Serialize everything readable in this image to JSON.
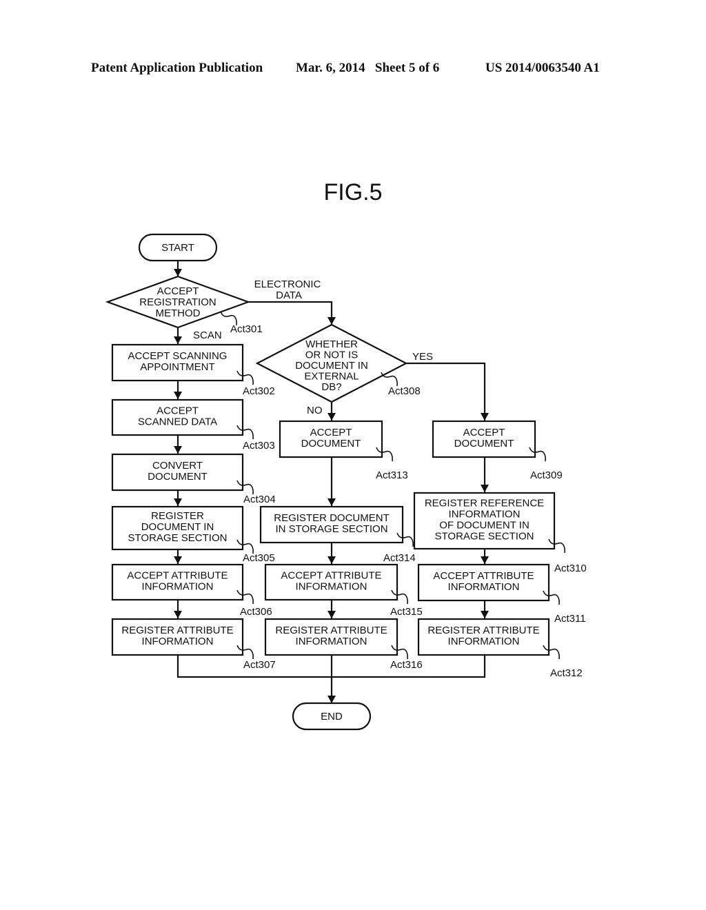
{
  "header": {
    "publication": "Patent Application Publication",
    "date_sheet": "Mar. 6, 2014   Sheet 5 of 6",
    "patent_number": "US 2014/0063540 A1"
  },
  "figure": {
    "title": "FIG.5"
  },
  "flowchart": {
    "start": "START",
    "end": "END",
    "nodes": [
      {
        "id": "Act301",
        "type": "decision",
        "lines": [
          "ACCEPT",
          "REGISTRATION",
          "METHOD"
        ],
        "ref": "Act301"
      },
      {
        "id": "Act302",
        "type": "process",
        "lines": [
          "ACCEPT SCANNING",
          "APPOINTMENT"
        ],
        "ref": "Act302"
      },
      {
        "id": "Act303",
        "type": "process",
        "lines": [
          "ACCEPT",
          "SCANNED DATA"
        ],
        "ref": "Act303"
      },
      {
        "id": "Act304",
        "type": "process",
        "lines": [
          "CONVERT",
          "DOCUMENT"
        ],
        "ref": "Act304"
      },
      {
        "id": "Act305",
        "type": "process",
        "lines": [
          "REGISTER",
          "DOCUMENT IN",
          "STORAGE SECTION"
        ],
        "ref": "Act305"
      },
      {
        "id": "Act306",
        "type": "process",
        "lines": [
          "ACCEPT ATTRIBUTE",
          "INFORMATION"
        ],
        "ref": "Act306"
      },
      {
        "id": "Act307",
        "type": "process",
        "lines": [
          "REGISTER ATTRIBUTE",
          "INFORMATION"
        ],
        "ref": "Act307"
      },
      {
        "id": "Act308",
        "type": "decision",
        "lines": [
          "WHETHER",
          "OR NOT IS",
          "DOCUMENT IN",
          "EXTERNAL",
          "DB?"
        ],
        "ref": "Act308"
      },
      {
        "id": "Act309",
        "type": "process",
        "lines": [
          "ACCEPT",
          "DOCUMENT"
        ],
        "ref": "Act309"
      },
      {
        "id": "Act310",
        "type": "process",
        "lines": [
          "REGISTER REFERENCE",
          "INFORMATION",
          "OF DOCUMENT IN",
          "STORAGE SECTION"
        ],
        "ref": "Act310"
      },
      {
        "id": "Act311",
        "type": "process",
        "lines": [
          "ACCEPT ATTRIBUTE",
          "INFORMATION"
        ],
        "ref": "Act311"
      },
      {
        "id": "Act312",
        "type": "process",
        "lines": [
          "REGISTER ATTRIBUTE",
          "INFORMATION"
        ],
        "ref": "Act312"
      },
      {
        "id": "Act313",
        "type": "process",
        "lines": [
          "ACCEPT",
          "DOCUMENT"
        ],
        "ref": "Act313"
      },
      {
        "id": "Act314",
        "type": "process",
        "lines": [
          "REGISTER DOCUMENT",
          "IN STORAGE SECTION"
        ],
        "ref": "Act314"
      },
      {
        "id": "Act315",
        "type": "process",
        "lines": [
          "ACCEPT ATTRIBUTE",
          "INFORMATION"
        ],
        "ref": "Act315"
      },
      {
        "id": "Act316",
        "type": "process",
        "lines": [
          "REGISTER ATTRIBUTE",
          "INFORMATION"
        ],
        "ref": "Act316"
      }
    ],
    "edge_labels": {
      "electronic_data": [
        "ELECTRONIC",
        "DATA"
      ],
      "scan": "SCAN",
      "yes": "YES",
      "no": "NO"
    },
    "edges": [
      [
        "START",
        "Act301"
      ],
      [
        "Act301",
        "Act302",
        "SCAN"
      ],
      [
        "Act301",
        "Act308",
        "ELECTRONIC DATA"
      ],
      [
        "Act302",
        "Act303"
      ],
      [
        "Act303",
        "Act304"
      ],
      [
        "Act304",
        "Act305"
      ],
      [
        "Act305",
        "Act306"
      ],
      [
        "Act306",
        "Act307"
      ],
      [
        "Act308",
        "Act309",
        "YES"
      ],
      [
        "Act308",
        "Act313",
        "NO"
      ],
      [
        "Act309",
        "Act310"
      ],
      [
        "Act310",
        "Act311"
      ],
      [
        "Act311",
        "Act312"
      ],
      [
        "Act313",
        "Act314"
      ],
      [
        "Act314",
        "Act315"
      ],
      [
        "Act315",
        "Act316"
      ],
      [
        "Act307",
        "END"
      ],
      [
        "Act316",
        "END"
      ],
      [
        "Act312",
        "END"
      ]
    ]
  }
}
